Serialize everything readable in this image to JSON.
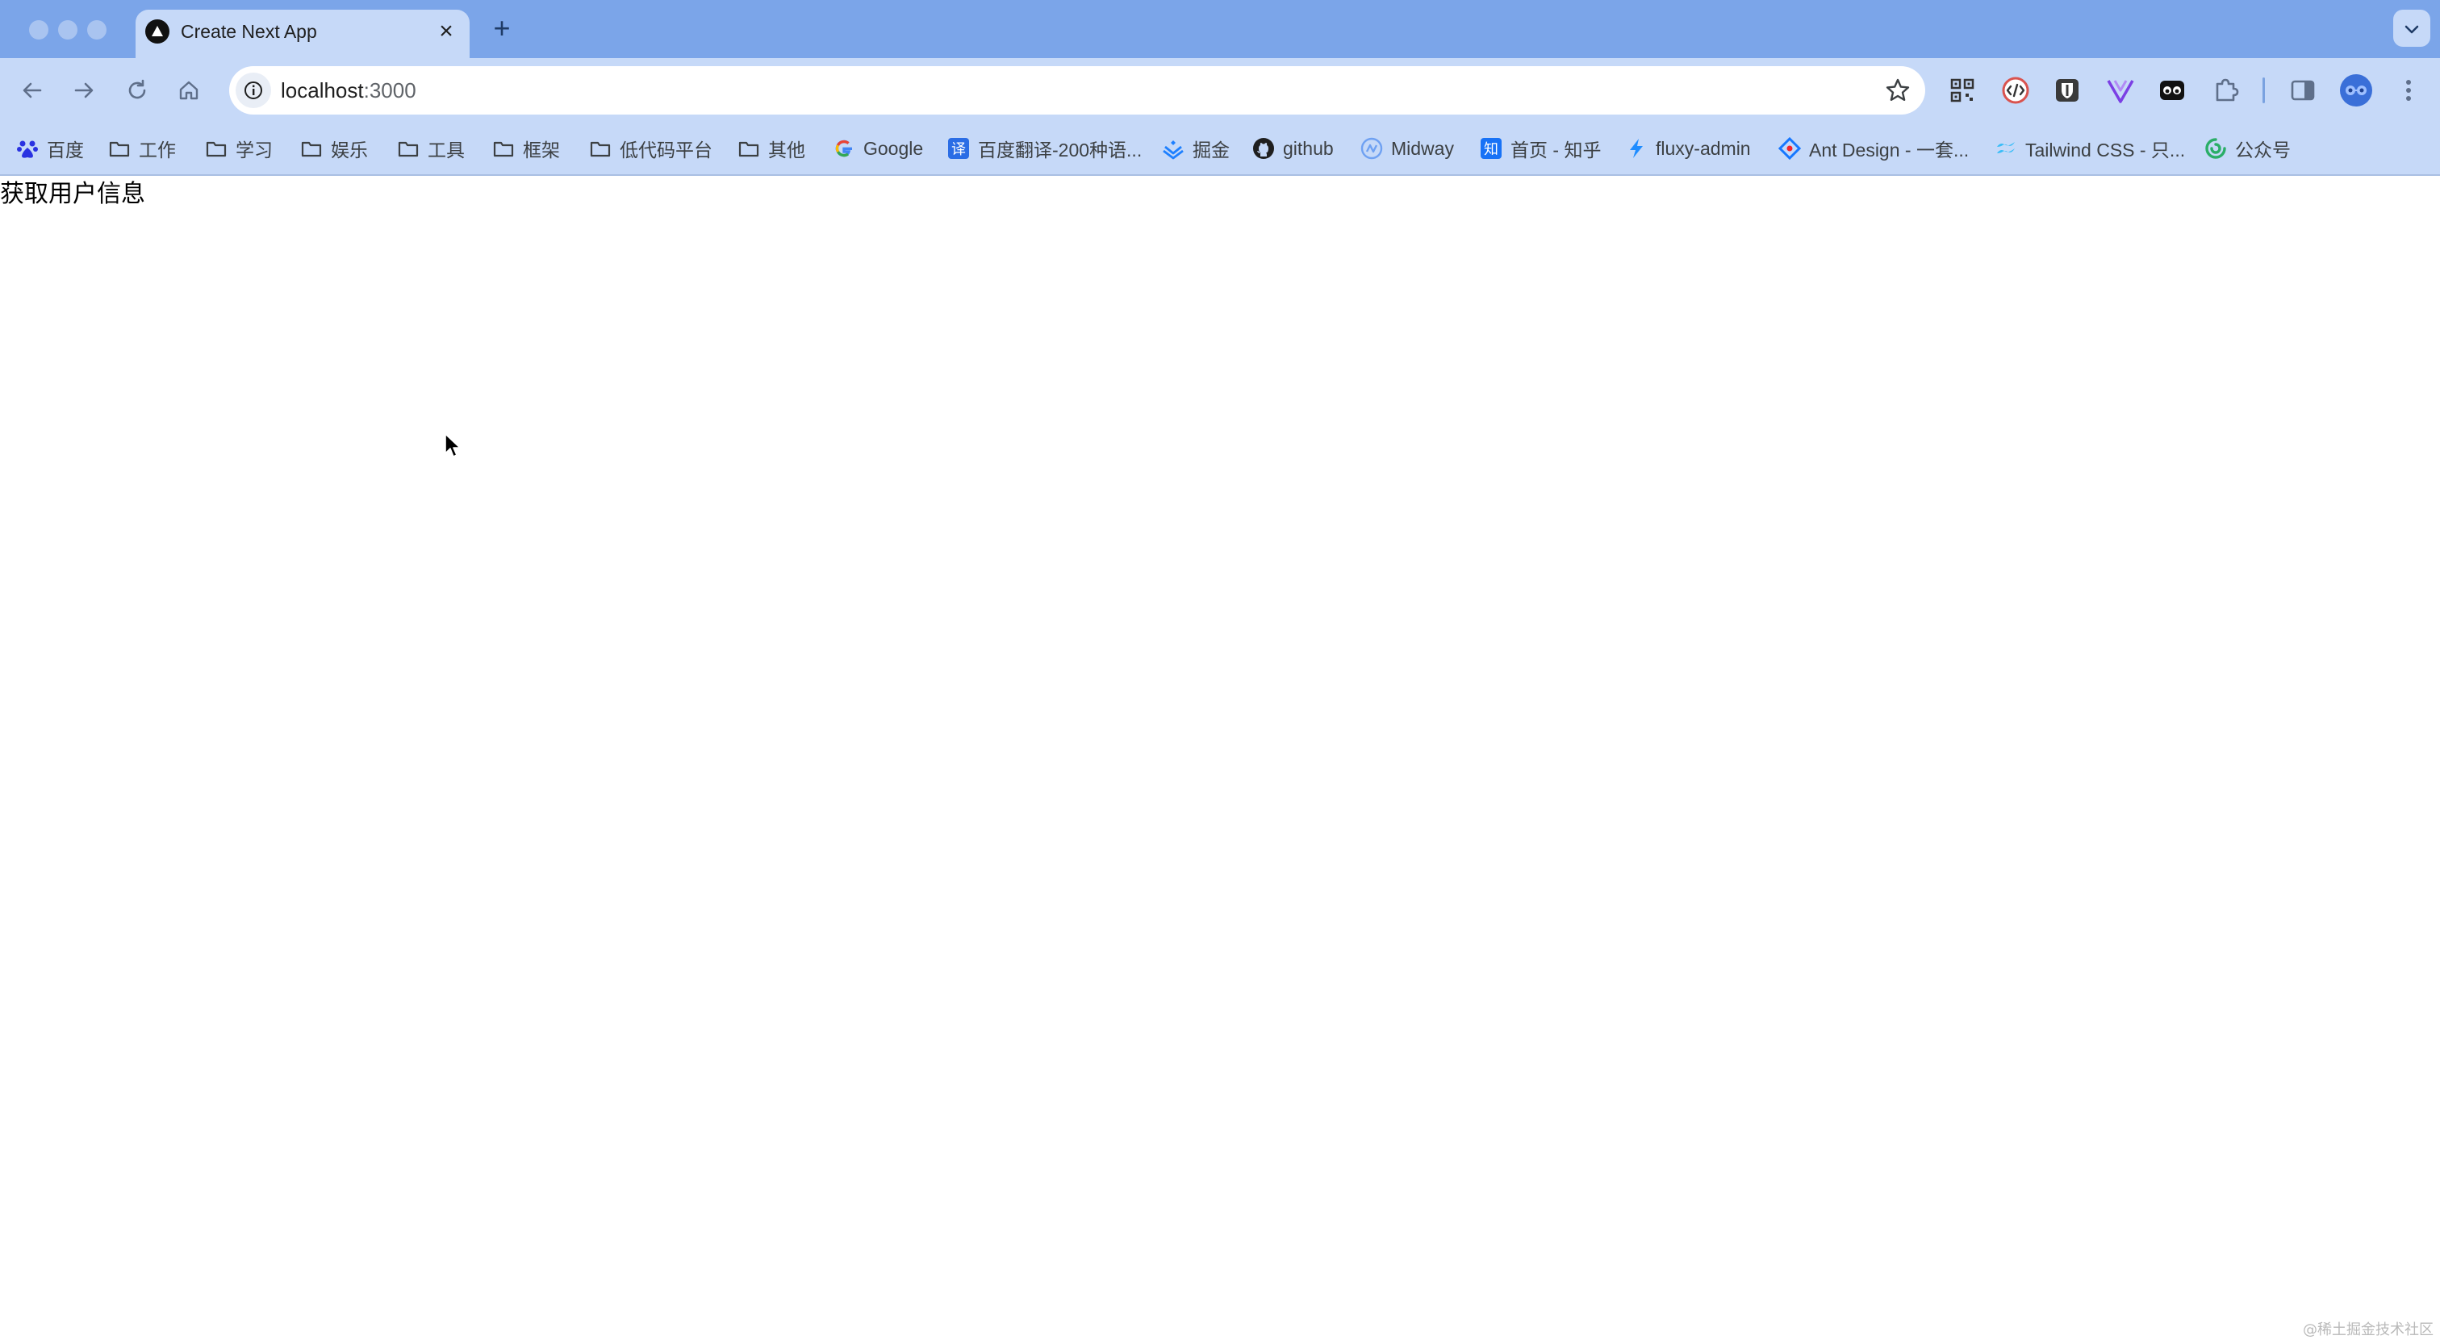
{
  "browser": {
    "tab": {
      "title": "Create Next App",
      "close_glyph": "×"
    },
    "new_tab_glyph": "+",
    "address": {
      "host": "localhost",
      "port": ":3000"
    }
  },
  "bookmarks": [
    {
      "label": "百度",
      "icon": "baidu-icon"
    },
    {
      "label": "工作",
      "icon": "folder-icon"
    },
    {
      "label": "学习",
      "icon": "folder-icon"
    },
    {
      "label": "娱乐",
      "icon": "folder-icon"
    },
    {
      "label": "工具",
      "icon": "folder-icon"
    },
    {
      "label": "框架",
      "icon": "folder-icon"
    },
    {
      "label": "低代码平台",
      "icon": "folder-icon"
    },
    {
      "label": "其他",
      "icon": "folder-icon"
    },
    {
      "label": "Google",
      "icon": "google-icon"
    },
    {
      "label": "百度翻译-200种语...",
      "icon": "translate-icon"
    },
    {
      "label": "掘金",
      "icon": "juejin-icon"
    },
    {
      "label": "github",
      "icon": "github-icon"
    },
    {
      "label": "Midway",
      "icon": "midway-icon"
    },
    {
      "label": "首页 - 知乎",
      "icon": "zhihu-icon"
    },
    {
      "label": "fluxy-admin",
      "icon": "bolt-icon"
    },
    {
      "label": "Ant Design - 一套...",
      "icon": "antd-icon"
    },
    {
      "label": "Tailwind CSS - 只...",
      "icon": "tailwind-icon"
    },
    {
      "label": "公众号",
      "icon": "wechat-icon"
    }
  ],
  "page": {
    "text": "获取用户信息",
    "watermark": "@稀土掘金技术社区"
  },
  "colors": {
    "tabstrip": "#7ba5e9",
    "toolbar": "#c6d9f8",
    "page_bg": "#ffffff"
  }
}
